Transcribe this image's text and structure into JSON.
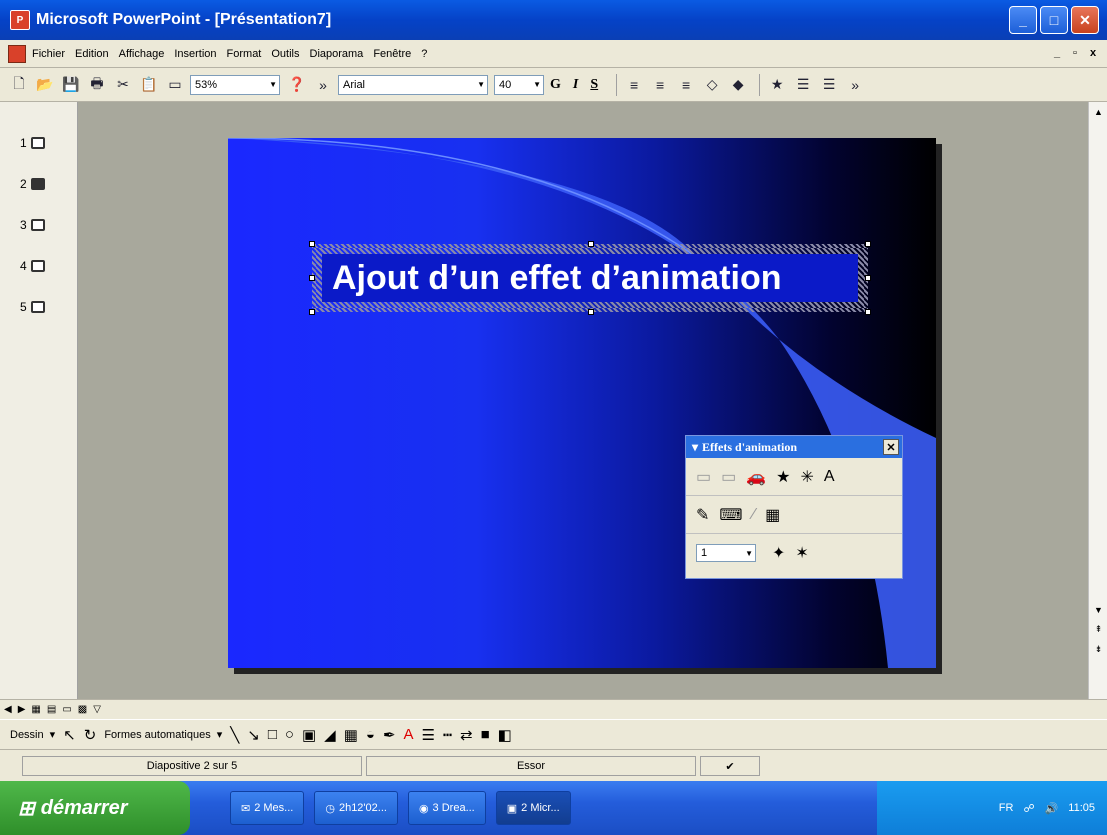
{
  "window": {
    "title": "Microsoft PowerPoint - [Présentation7]",
    "min": "_",
    "max": "□",
    "close": "✕"
  },
  "menu": {
    "items": [
      "Fichier",
      "Edition",
      "Affichage",
      "Insertion",
      "Format",
      "Outils",
      "Diaporama",
      "Fenêtre",
      "?"
    ],
    "right": [
      "_",
      "▫",
      "x"
    ]
  },
  "toolbar": {
    "zoom": "53%",
    "font": "Arial",
    "size": "40",
    "bold": "G",
    "italic": "I",
    "shadow": "S"
  },
  "slides": [
    {
      "num": "1"
    },
    {
      "num": "2"
    },
    {
      "num": "3"
    },
    {
      "num": "4"
    },
    {
      "num": "5"
    }
  ],
  "slide": {
    "title": "Ajout d’un effet d’animation"
  },
  "panel": {
    "title": "Effets d'animation",
    "close": "✕",
    "order": "1"
  },
  "drawbar": {
    "draw": "Dessin",
    "shapes": "Formes automatiques"
  },
  "status": {
    "slide": "Diapositive 2 sur 5",
    "design": "Essor"
  },
  "taskbar": {
    "start": "démarrer",
    "tasks": [
      "2 Mes...",
      "2h12'02...",
      "3 Drea...",
      "2 Micr..."
    ],
    "lang": "FR",
    "clock": "11:05"
  }
}
